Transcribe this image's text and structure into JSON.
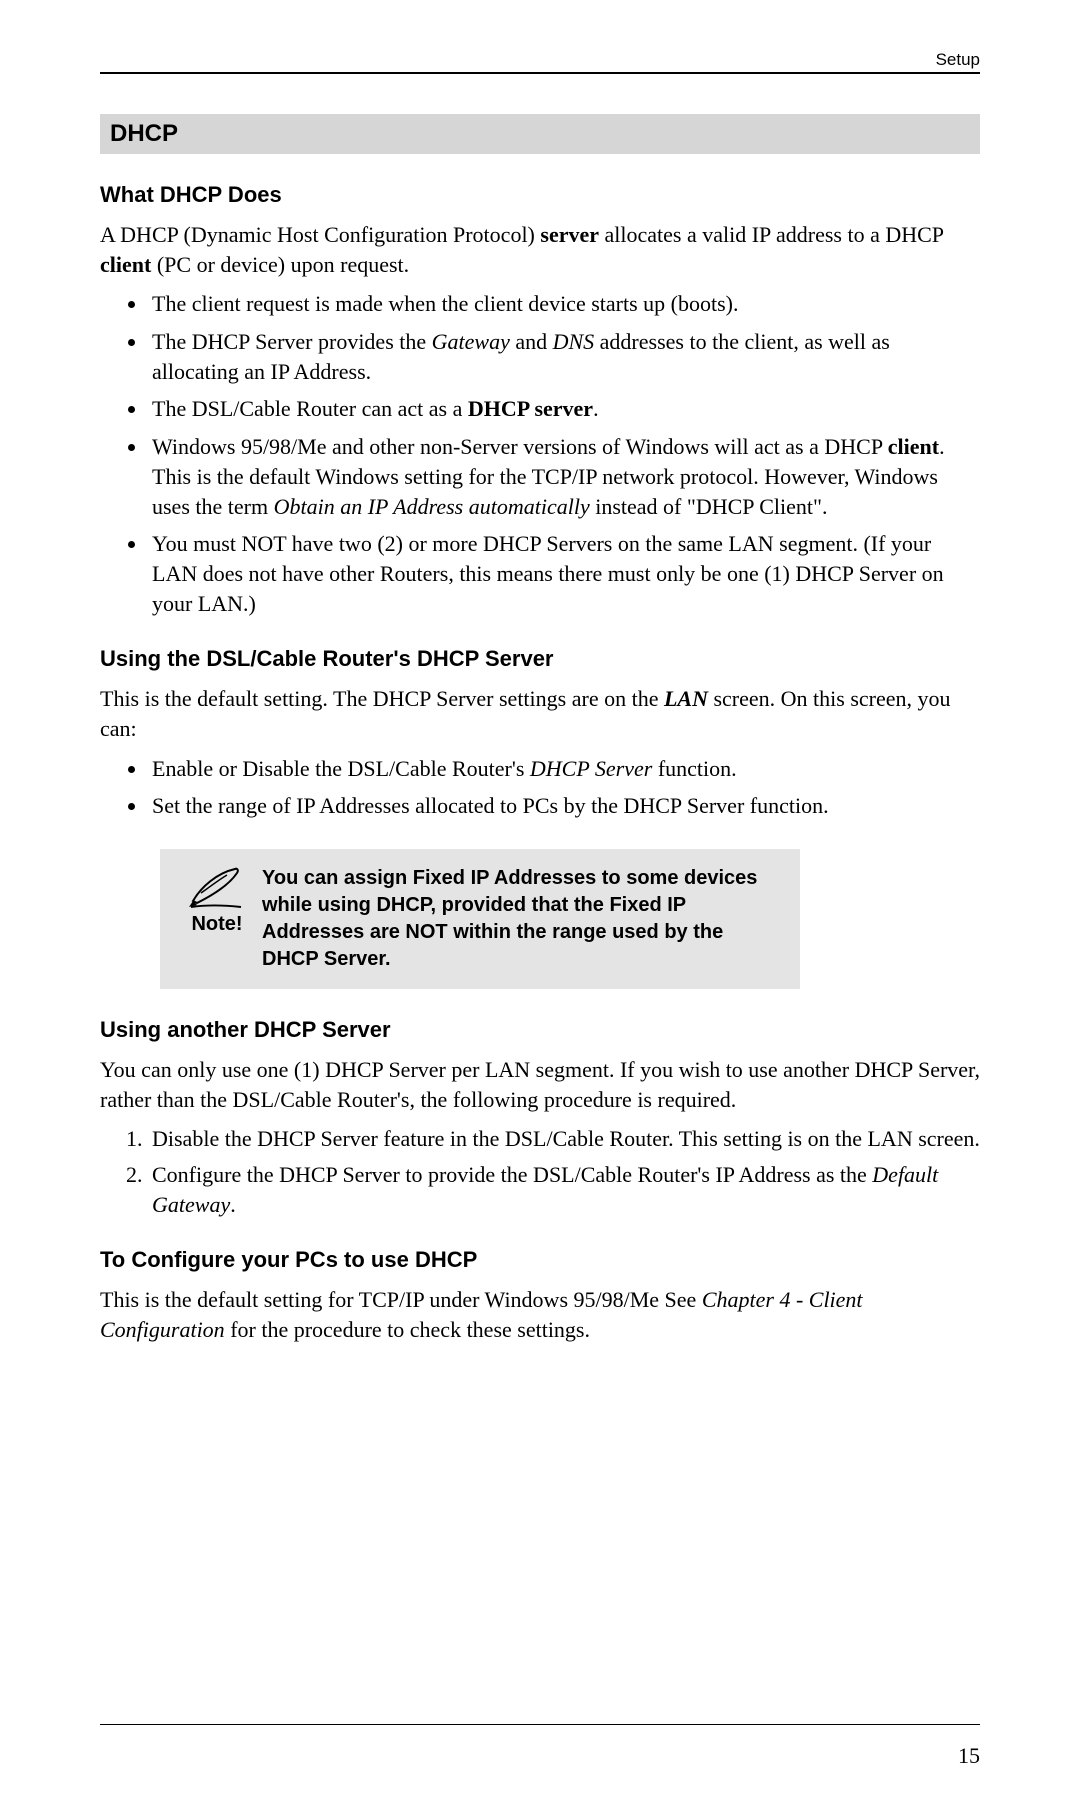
{
  "header": {
    "section_label": "Setup"
  },
  "section_title": "DHCP",
  "s1": {
    "heading": "What DHCP Does",
    "intro_parts": {
      "p1": "A DHCP (Dynamic Host Configuration Protocol) ",
      "b1": "server",
      "p2": " allocates a valid IP address to a DHCP ",
      "b2": "client",
      "p3": " (PC or device) upon request."
    },
    "bul1": "The client request is made when the client device starts up (boots).",
    "bul2": {
      "p1": "The DHCP Server provides the ",
      "i1": "Gateway",
      "p2": " and ",
      "i2": "DNS",
      "p3": " addresses to the client, as well as allocating an IP Address."
    },
    "bul3": {
      "p1": "The DSL/Cable Router can act as a ",
      "b1": "DHCP server",
      "p2": "."
    },
    "bul4": {
      "p1": "Windows 95/98/Me and other non-Server versions of Windows will act as a DHCP ",
      "b1": "client",
      "p2": ". This is the default Windows setting for the TCP/IP network protocol. However, Windows uses the term ",
      "i1": "Obtain an IP Address automatically",
      "p3": " instead of \"DHCP Client\"."
    },
    "bul5": "You must NOT have two (2) or more DHCP Servers on the same LAN segment. (If your LAN does not have other Routers, this means there must only be one (1) DHCP Server on your LAN.)"
  },
  "s2": {
    "heading": "Using the DSL/Cable Router's DHCP Server",
    "intro": {
      "p1": "This is the default setting. The DHCP Server settings are on the ",
      "i1": "LAN",
      "p2": " screen. On this screen, you can:"
    },
    "bul1": {
      "p1": "Enable or Disable the DSL/Cable Router's ",
      "i1": "DHCP Server",
      "p2": " function."
    },
    "bul2": "Set the range of IP Addresses allocated to PCs by the DHCP Server function."
  },
  "note": {
    "label": "Note!",
    "text": "You can assign Fixed IP Addresses to some devices while using DHCP, provided that the Fixed IP Addresses are NOT within the range used by the DHCP Server."
  },
  "s3": {
    "heading": "Using another DHCP Server",
    "intro": "You can only use one (1) DHCP Server per LAN segment. If you wish to use another DHCP Server, rather than the DSL/Cable Router's, the following procedure is required.",
    "li1": "Disable the DHCP Server feature in the DSL/Cable Router. This setting is on the LAN screen.",
    "li2": {
      "p1": "Configure the DHCP Server to provide the DSL/Cable Router's IP Address as the ",
      "i1": "Default Gateway",
      "p2": "."
    }
  },
  "s4": {
    "heading": "To Configure your PCs to use DHCP",
    "intro": {
      "p1": "This is the default setting for TCP/IP under Windows 95/98/Me See ",
      "i1": "Chapter 4 - Client Configuration",
      "p2": " for the procedure to check these settings."
    }
  },
  "footer": {
    "page_number": "15"
  }
}
